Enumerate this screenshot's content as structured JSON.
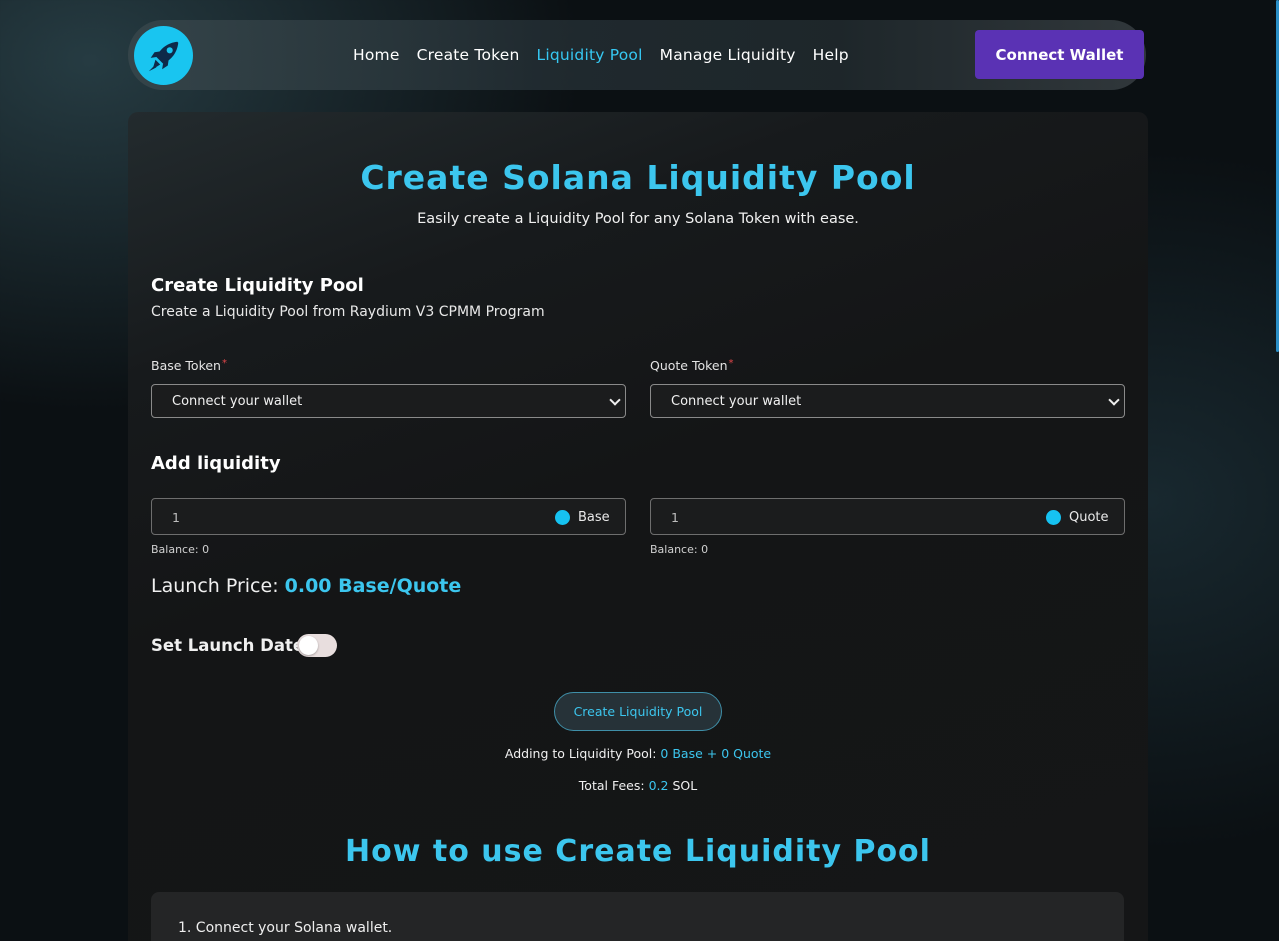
{
  "nav": {
    "logo_icon": "rocket-icon",
    "links": [
      {
        "label": "Home",
        "active": false
      },
      {
        "label": "Create Token",
        "active": false
      },
      {
        "label": "Liquidity Pool",
        "active": true
      },
      {
        "label": "Manage Liquidity",
        "active": false
      },
      {
        "label": "Help",
        "active": false
      }
    ],
    "connect_label": "Connect Wallet"
  },
  "header": {
    "title": "Create Solana Liquidity Pool",
    "subtitle": "Easily create a Liquidity Pool for any Solana Token with ease."
  },
  "form": {
    "title": "Create Liquidity Pool",
    "subtitle": "Create a Liquidity Pool from Raydium V3 CPMM Program",
    "base_token_label": "Base Token",
    "quote_token_label": "Quote Token",
    "required_mark": "*",
    "base_select_value": "Connect your wallet",
    "quote_select_value": "Connect your wallet",
    "add_liquidity_title": "Add liquidity",
    "base_amount": "1",
    "quote_amount": "1",
    "base_token_name": "Base",
    "quote_token_name": "Quote",
    "base_balance": "Balance: 0",
    "quote_balance": "Balance: 0",
    "launch_price_label": "Launch Price:",
    "launch_price_value": "0.00 Base/Quote",
    "launch_date_label": "Set Launch Date",
    "launch_date_enabled": false,
    "create_button": "Create Liquidity Pool",
    "adding_label": "Adding to Liquidity Pool:",
    "adding_value": "0 Base + 0 Quote",
    "fees_label": "Total Fees:",
    "fees_value": "0.2",
    "fees_unit": "SOL"
  },
  "howto": {
    "title": "How to use Create Liquidity Pool",
    "steps": [
      "1. Connect your Solana wallet."
    ]
  },
  "colors": {
    "accent": "#3cc6ee",
    "connect_button": "#5a32b4",
    "token_dot": "#16c2f1",
    "required": "#e0464a"
  }
}
